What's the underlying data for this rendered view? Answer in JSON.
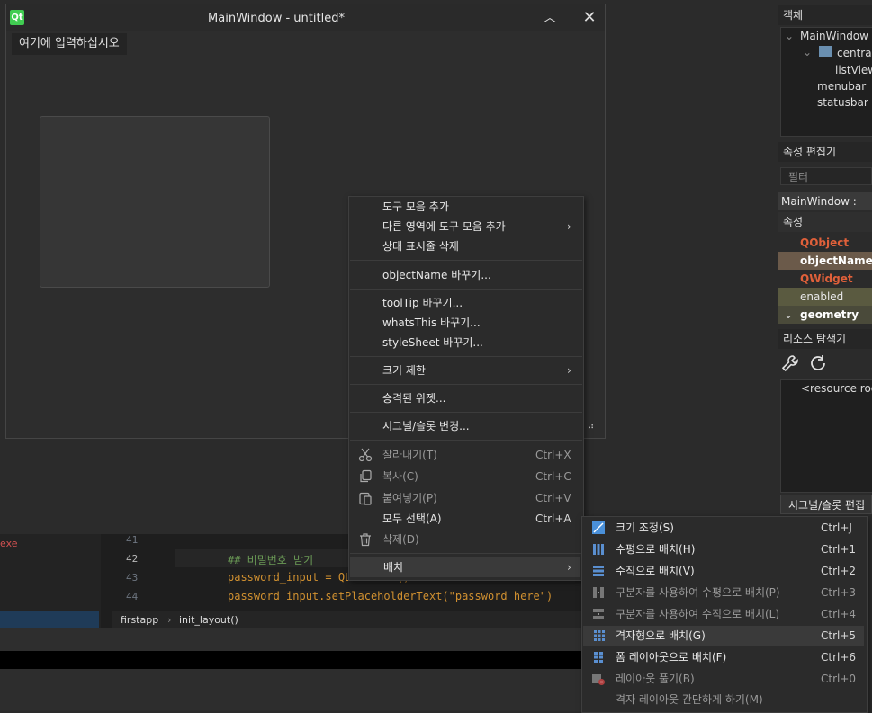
{
  "form": {
    "window_title": "MainWindow - untitled*",
    "qt_logo": "Qt",
    "menu_placeholder": "여기에 입력하십시오"
  },
  "editor": {
    "left_text": "exe",
    "line_numbers": [
      "41",
      "42",
      "43",
      "44"
    ],
    "code_lines": [
      "",
      "## 비밀번호 받기",
      "password_input = QLineEdit()",
      "password_input.setPlaceholderText(\"password here\")"
    ],
    "breadcrumb": [
      "firstapp",
      "init_layout()"
    ]
  },
  "dock": {
    "objects_header": "객체",
    "objects_tree": [
      "MainWindow",
      "centralw",
      "listView",
      "menubar",
      "statusbar"
    ],
    "props_header": "속성 편집기",
    "filter_placeholder": "필터",
    "selected_class": "MainWindow : QM",
    "props_col": "속성",
    "props": [
      "QObject",
      "objectName",
      "QWidget",
      "enabled",
      "geometry"
    ],
    "resource_header": "리소스 탐색기",
    "resource_root": "<resource root",
    "signal_tab": "시그널/슬롯 편집"
  },
  "context_menu": {
    "items": [
      {
        "label": "도구 모음 추가"
      },
      {
        "label": "다른 영역에 도구 모음 추가",
        "submenu": true
      },
      {
        "label": "상태 표시줄 삭제"
      },
      {
        "label": "objectName 바꾸기..."
      },
      {
        "label": "toolTip 바꾸기..."
      },
      {
        "label": "whatsThis 바꾸기..."
      },
      {
        "label": "styleSheet 바꾸기..."
      },
      {
        "label": "크기 제한",
        "submenu": true
      },
      {
        "label": "승격된 위젯..."
      },
      {
        "label": "시그널/슬롯 변경..."
      },
      {
        "label": "잘라내기(T)",
        "shortcut": "Ctrl+X",
        "icon": "scissors-icon"
      },
      {
        "label": "복사(C)",
        "shortcut": "Ctrl+C",
        "icon": "copy-icon"
      },
      {
        "label": "붙여넣기(P)",
        "shortcut": "Ctrl+V",
        "icon": "paste-icon"
      },
      {
        "label": "모두 선택(A)",
        "shortcut": "Ctrl+A"
      },
      {
        "label": "삭제(D)",
        "icon": "trash-icon"
      },
      {
        "label": "배치",
        "submenu": true
      }
    ]
  },
  "layout_submenu": {
    "items": [
      {
        "label": "크기 조정(S)",
        "shortcut": "Ctrl+J",
        "icon": "adjust-size-icon"
      },
      {
        "label": "수평으로 배치(H)",
        "shortcut": "Ctrl+1",
        "icon": "horizontal-layout-icon"
      },
      {
        "label": "수직으로 배치(V)",
        "shortcut": "Ctrl+2",
        "icon": "vertical-layout-icon"
      },
      {
        "label": "구분자를 사용하여 수평으로 배치(P)",
        "shortcut": "Ctrl+3",
        "icon": "h-splitter-icon"
      },
      {
        "label": "구분자를 사용하여 수직으로 배치(L)",
        "shortcut": "Ctrl+4",
        "icon": "v-splitter-icon"
      },
      {
        "label": "격자형으로 배치(G)",
        "shortcut": "Ctrl+5",
        "icon": "grid-layout-icon"
      },
      {
        "label": "폼 레이아웃으로 배치(F)",
        "shortcut": "Ctrl+6",
        "icon": "form-layout-icon"
      },
      {
        "label": "레이아웃 풀기(B)",
        "shortcut": "Ctrl+0",
        "icon": "break-layout-icon"
      },
      {
        "label": "격자 레이아웃 간단하게 하기(M)"
      }
    ]
  },
  "colors": {
    "accent_blue": "#4a90d9",
    "qt_green": "#41cd52",
    "property_orange": "#e0603a",
    "selected_row": "#3a3a3a"
  }
}
